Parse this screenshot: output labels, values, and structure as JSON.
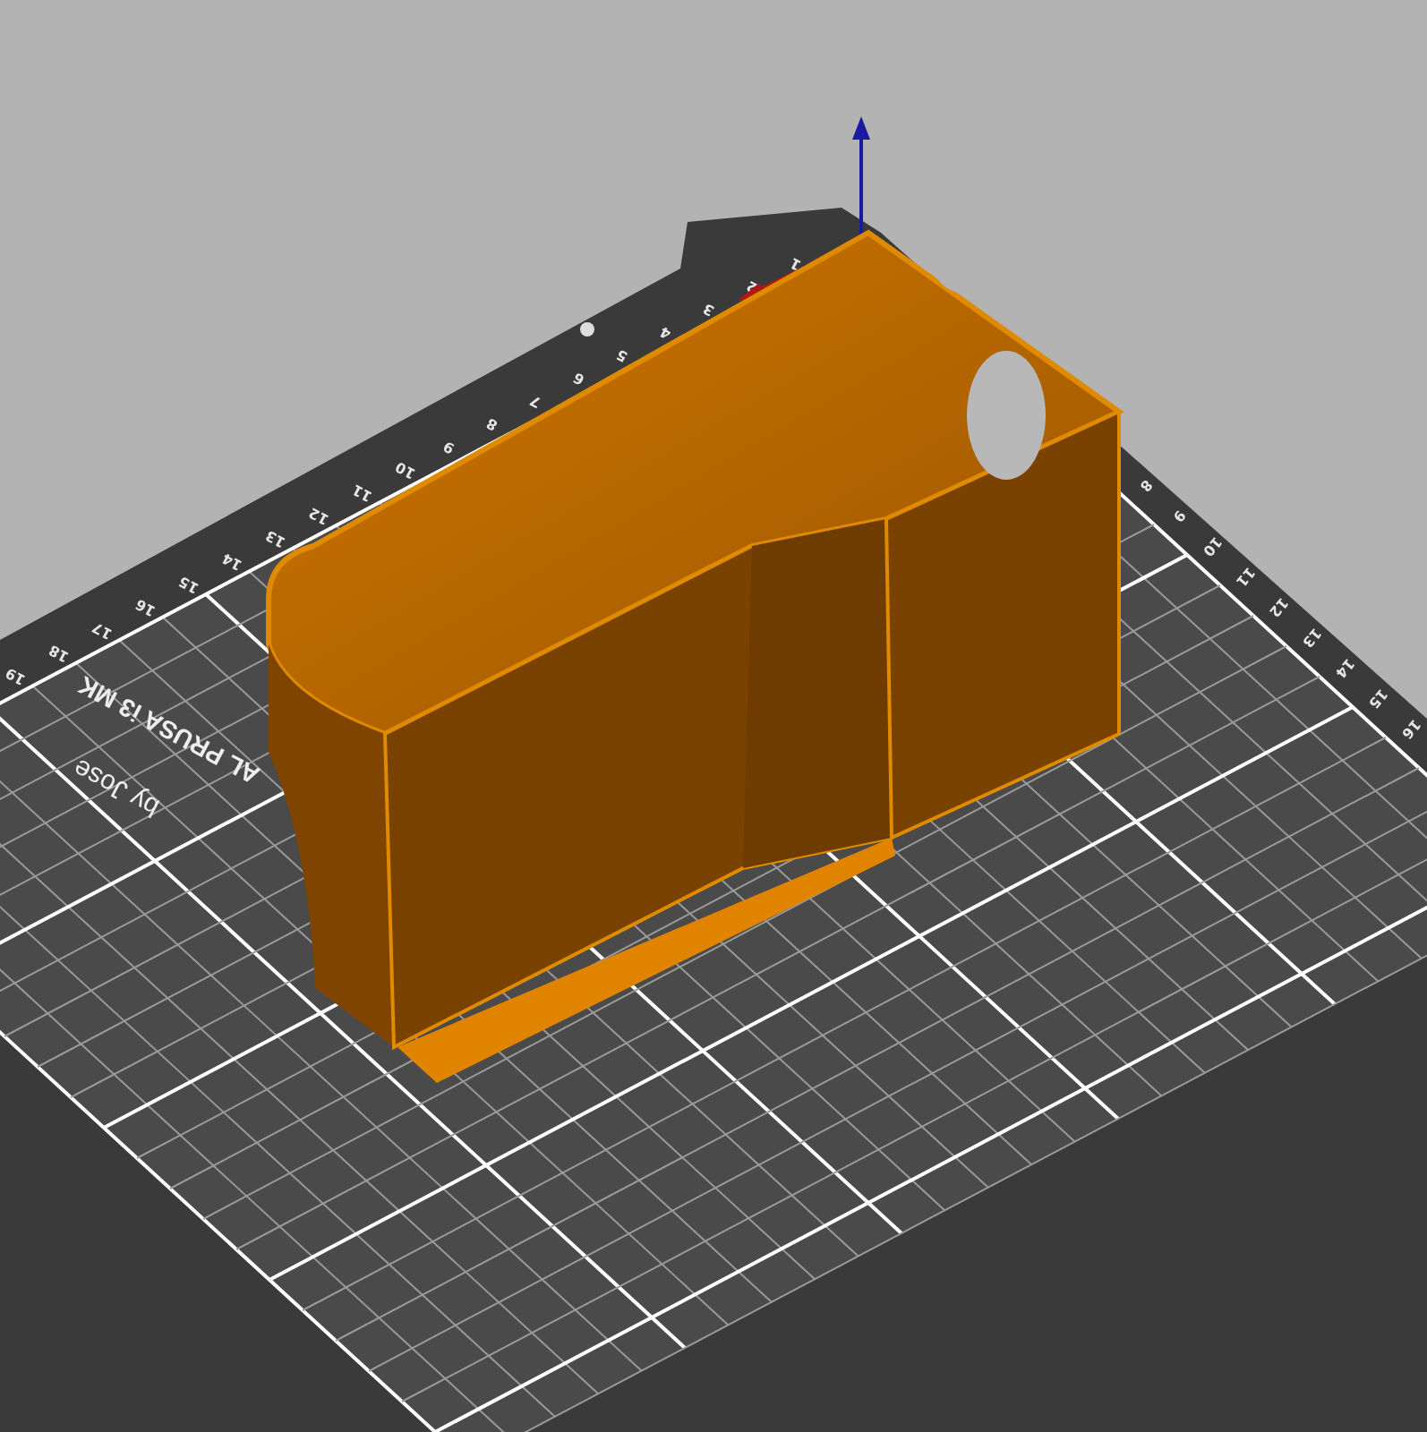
{
  "viewport": {
    "bed": {
      "label": "AL PRUSA i3 MK",
      "sublabel": "by Jose",
      "x_ruler": [
        "1",
        "2",
        "3",
        "4",
        "5",
        "6",
        "7",
        "8",
        "9",
        "10",
        "11",
        "12",
        "13",
        "14",
        "15",
        "16",
        "17",
        "18",
        "19"
      ],
      "y_ruler": [
        "8",
        "9",
        "10",
        "11",
        "12",
        "13",
        "14",
        "15",
        "16"
      ]
    }
  }
}
